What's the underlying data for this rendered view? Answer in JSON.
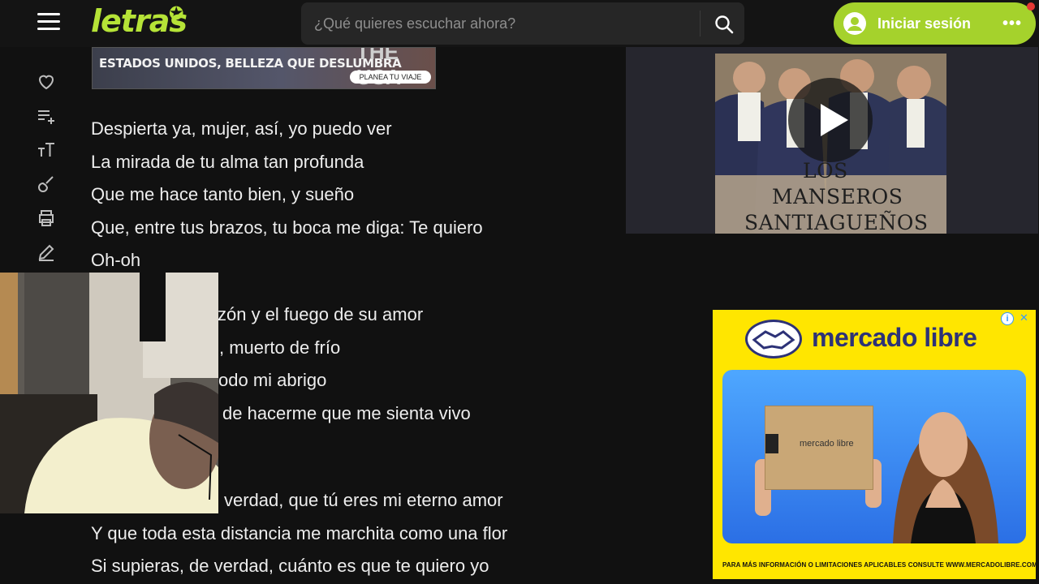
{
  "colors": {
    "accent": "#a5d22c",
    "logo": "#b5e337",
    "background": "#111111",
    "header": "#141414",
    "notification": "#e53935",
    "ad_yellow": "#ffe600",
    "ad_blue": "#2d3277"
  },
  "header": {
    "logo": "letras",
    "search_placeholder": "¿Qué quieres escuchar ahora?",
    "login_label": "Iniciar sesión",
    "more_label": "•••"
  },
  "sidebar": {
    "icons": [
      "heart-icon",
      "add-to-playlist-icon",
      "text-size-icon",
      "guitar-icon",
      "print-icon",
      "edit-icon"
    ]
  },
  "banner": {
    "headline": "ESTADOS UNIDOS, BELLEZA QUE DESLUMBRA",
    "brand": "THE USA",
    "cta": "PLANEA TU VIAJE"
  },
  "lyrics": [
    "Despierta ya, mujer, así, yo puedo ver",
    "La mirada de tu alma tan profunda",
    "Que me hace tanto bien, y sueño",
    "Que, entre tus brazos, tu boca me diga: Te quiero",
    "Oh-oh",
    "zón y el fuego de su amor",
    ", muerto de frío",
    "odo mi abrigo",
    "de hacerme que me sienta vivo",
    "verdad, que tú eres mi eterno amor",
    "Y que toda esta distancia me marchita como una flor",
    "Si supieras, de verdad, cuánto es que te quiero yo"
  ],
  "video": {
    "title_line1": "LOS",
    "title_line2": "MANSEROS",
    "title_line3": "SANTIAGUEÑOS"
  },
  "ad": {
    "brand": "mercado libre",
    "info": "i",
    "close": "✕",
    "box_text": "mercado libre",
    "legal": "PARA MÁS INFORMACIÓN O LIMITACIONES APLICABLES CONSULTE WWW.MERCADOLIBRE.COM.AR"
  }
}
